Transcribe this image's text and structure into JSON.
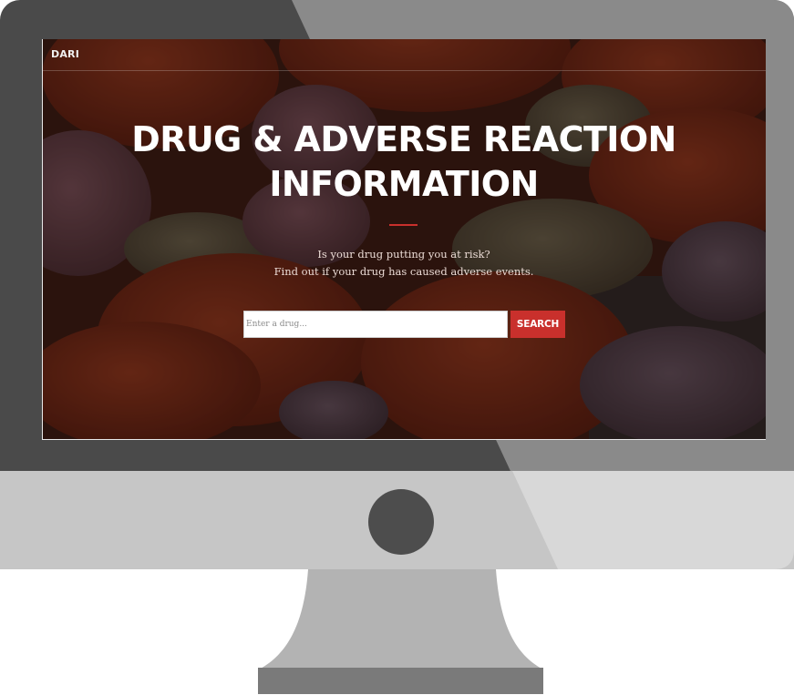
{
  "nav": {
    "brand": "DARI"
  },
  "hero": {
    "title_line1": "DRUG & ADVERSE REACTION",
    "title_line2": "INFORMATION",
    "subtitle_line1": "Is your drug putting you at risk?",
    "subtitle_line2": "Find out if your drug has caused adverse events."
  },
  "search": {
    "placeholder": "Enter a drug...",
    "value": "",
    "button_label": "SEARCH"
  },
  "colors": {
    "accent": "#c9302c",
    "bezel": "#4a4a4a",
    "chin": "#c6c6c6",
    "stand": "#b3b3b3",
    "foot": "#7a7a7a"
  }
}
